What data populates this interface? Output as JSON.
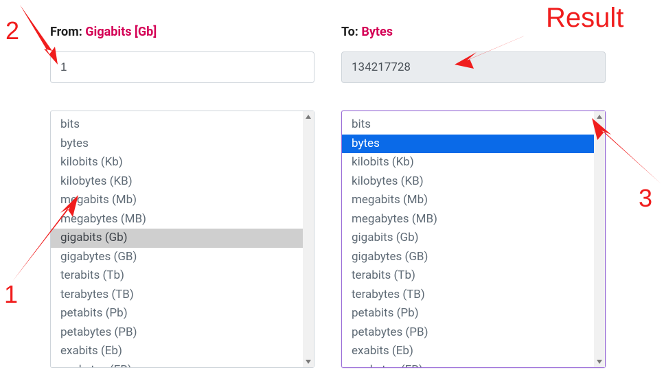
{
  "from": {
    "label_prefix": "From:",
    "unit_display": "Gigabits [Gb]",
    "value": "1",
    "selected_index": 6
  },
  "to": {
    "label_prefix": "To:",
    "unit_display": "Bytes",
    "value": "134217728",
    "selected_index": 1
  },
  "units": [
    "bits",
    "bytes",
    "kilobits (Kb)",
    "kilobytes (KB)",
    "megabits (Mb)",
    "megabytes (MB)",
    "gigabits (Gb)",
    "gigabytes (GB)",
    "terabits (Tb)",
    "terabytes (TB)",
    "petabits (Pb)",
    "petabytes (PB)",
    "exabits (Eb)",
    "exabytes (EB)"
  ],
  "annotations": {
    "n1": "1",
    "n2": "2",
    "n3": "3",
    "result": "Result"
  },
  "colors": {
    "accent_pink": "#d40055",
    "annotation_red": "#f01d1d",
    "selected_blue": "#0a6ae8",
    "selected_grey": "#cfcfcf"
  }
}
